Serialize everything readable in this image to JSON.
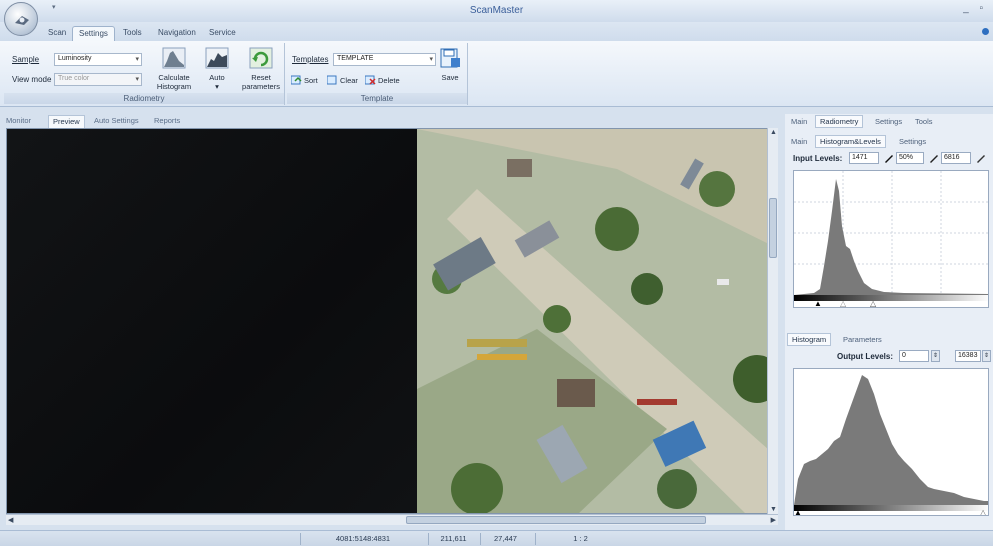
{
  "app": {
    "title": "ScanMaster",
    "window_controls": "_ ▫"
  },
  "ribbon_tabs": [
    {
      "label": "Scan"
    },
    {
      "label": "Settings"
    },
    {
      "label": "Tools"
    },
    {
      "label": "Navigation"
    },
    {
      "label": "Service"
    }
  ],
  "radiometry_group": {
    "label": "Radiometry",
    "sample_label": "Sample",
    "sample_value": "Luminosity",
    "view_mode_label": "View mode",
    "view_mode_value": "True color",
    "calc_histogram": "Calculate Histogram",
    "auto": "Auto",
    "reset": "Reset parameters"
  },
  "template_group": {
    "label": "Template",
    "templates_label": "Templates",
    "templates_value": "TEMPLATE",
    "sort": "Sort",
    "clear": "Clear",
    "delete": "Delete",
    "save": "Save"
  },
  "doc_tabs": [
    {
      "label": "Monitor"
    },
    {
      "label": "Preview"
    },
    {
      "label": "Auto Settings"
    },
    {
      "label": "Reports"
    }
  ],
  "right_panel": {
    "top_tabs": [
      "Main",
      "Radiometry",
      "Settings",
      "Tools"
    ],
    "sub_tabs": [
      "Main",
      "Histogram&Levels",
      "Settings"
    ],
    "input_levels_label": "Input Levels:",
    "input_low": "1471",
    "input_mid": "50%",
    "input_high": "6816",
    "bottom_tabs": [
      "Histogram",
      "Parameters"
    ],
    "output_levels_label": "Output Levels:",
    "output_low": "0",
    "output_high": "16383"
  },
  "status": {
    "cell1": "4081:5148:4831",
    "cell2": "211,611",
    "cell3": "27,447",
    "cell4": "1 : 2"
  },
  "colors": {
    "accent": "#3b5f9a",
    "ribbon_bg": "#dbe6f3",
    "histogram_fill": "#7a7a7a"
  }
}
